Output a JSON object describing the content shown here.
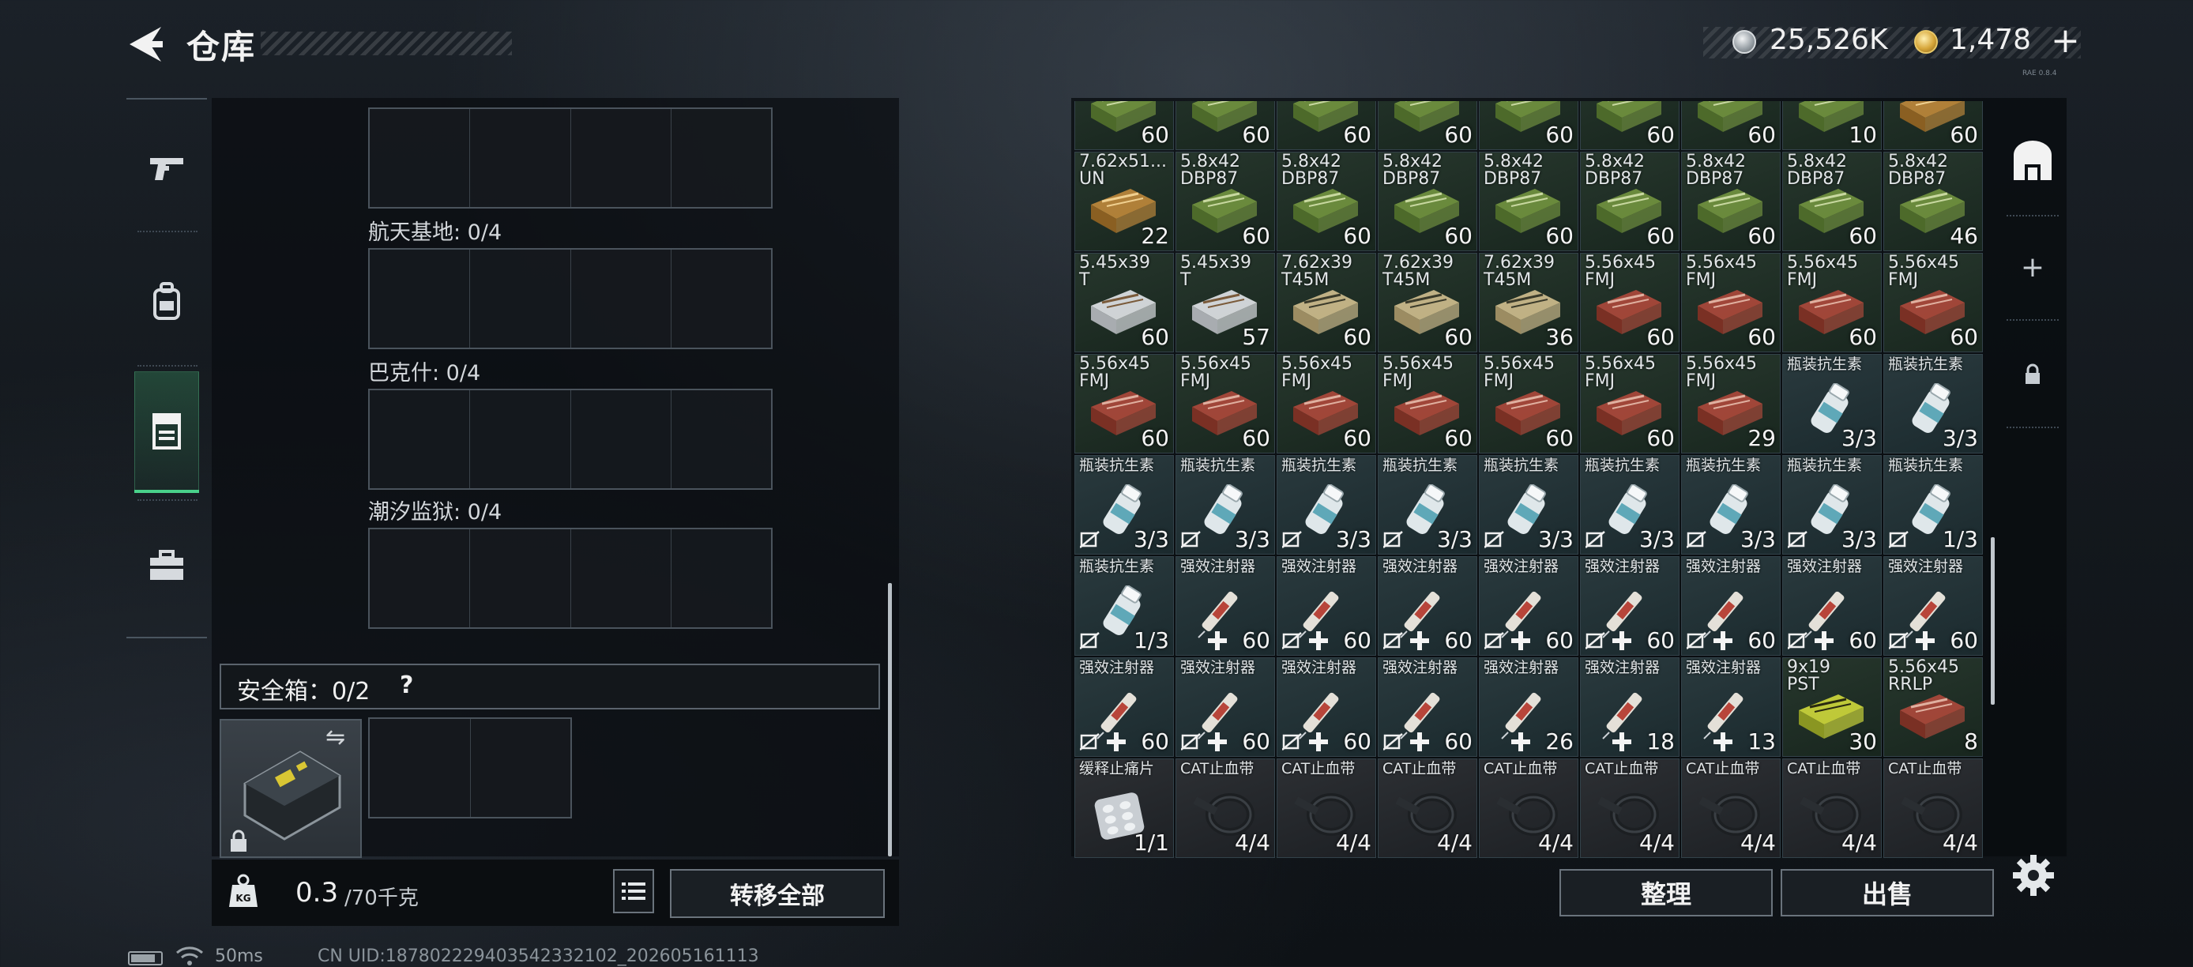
{
  "header": {
    "title": "仓库",
    "currency": {
      "silver_amount": "25,526K",
      "gold_amount": "1,478",
      "add_label": "+"
    },
    "version": "RAE 0.8.4"
  },
  "left_nav": {
    "tabs": [
      {
        "name": "weapons",
        "icon": "pistol-icon",
        "active": false
      },
      {
        "name": "gear",
        "icon": "backpack-icon",
        "active": false
      },
      {
        "name": "storage",
        "icon": "locker-icon",
        "active": true
      },
      {
        "name": "toolbox",
        "icon": "toolbox-icon",
        "active": false
      }
    ]
  },
  "stash": {
    "rows": [
      {
        "label": ""
      },
      {
        "label": "航天基地: 0/4"
      },
      {
        "label": "巴克什: 0/4"
      },
      {
        "label": "潮汐监狱: 0/4"
      }
    ],
    "safebox_label": "安全箱：0/2",
    "safebox_help": "?",
    "weight_current": "0.3",
    "weight_max": "/70千克",
    "transfer_all": "转移全部"
  },
  "inventory": {
    "accent": "#49d18a",
    "items": [
      {
        "name": "",
        "qty": "60",
        "type": "ammo-green"
      },
      {
        "name": "",
        "qty": "60",
        "type": "ammo-green"
      },
      {
        "name": "",
        "qty": "60",
        "type": "ammo-green"
      },
      {
        "name": "",
        "qty": "60",
        "type": "ammo-green"
      },
      {
        "name": "",
        "qty": "60",
        "type": "ammo-green"
      },
      {
        "name": "",
        "qty": "60",
        "type": "ammo-green"
      },
      {
        "name": "",
        "qty": "60",
        "type": "ammo-green"
      },
      {
        "name": "",
        "qty": "10",
        "type": "ammo-green"
      },
      {
        "name": "",
        "qty": "60",
        "type": "ammo-box"
      },
      {
        "name": "7.62x51...\nUN",
        "qty": "22",
        "type": "ammo-box"
      },
      {
        "name": "5.8x42\nDBP87",
        "qty": "60",
        "type": "ammo-green"
      },
      {
        "name": "5.8x42\nDBP87",
        "qty": "60",
        "type": "ammo-green"
      },
      {
        "name": "5.8x42\nDBP87",
        "qty": "60",
        "type": "ammo-green"
      },
      {
        "name": "5.8x42\nDBP87",
        "qty": "60",
        "type": "ammo-green"
      },
      {
        "name": "5.8x42\nDBP87",
        "qty": "60",
        "type": "ammo-green"
      },
      {
        "name": "5.8x42\nDBP87",
        "qty": "60",
        "type": "ammo-green"
      },
      {
        "name": "5.8x42\nDBP87",
        "qty": "60",
        "type": "ammo-green"
      },
      {
        "name": "5.8x42\nDBP87",
        "qty": "46",
        "type": "ammo-green"
      },
      {
        "name": "5.45x39\nT",
        "qty": "60",
        "type": "ammo-white"
      },
      {
        "name": "5.45x39\nT",
        "qty": "57",
        "type": "ammo-white"
      },
      {
        "name": "7.62x39\nT45M",
        "qty": "60",
        "type": "ammo-tan"
      },
      {
        "name": "7.62x39\nT45M",
        "qty": "60",
        "type": "ammo-tan"
      },
      {
        "name": "7.62x39\nT45M",
        "qty": "36",
        "type": "ammo-tan"
      },
      {
        "name": "5.56x45\nFMJ",
        "qty": "60",
        "type": "ammo-red"
      },
      {
        "name": "5.56x45\nFMJ",
        "qty": "60",
        "type": "ammo-red"
      },
      {
        "name": "5.56x45\nFMJ",
        "qty": "60",
        "type": "ammo-red"
      },
      {
        "name": "5.56x45\nFMJ",
        "qty": "60",
        "type": "ammo-red"
      },
      {
        "name": "5.56x45\nFMJ",
        "qty": "60",
        "type": "ammo-red"
      },
      {
        "name": "5.56x45\nFMJ",
        "qty": "60",
        "type": "ammo-red"
      },
      {
        "name": "5.56x45\nFMJ",
        "qty": "60",
        "type": "ammo-red"
      },
      {
        "name": "5.56x45\nFMJ",
        "qty": "60",
        "type": "ammo-red"
      },
      {
        "name": "5.56x45\nFMJ",
        "qty": "60",
        "type": "ammo-red"
      },
      {
        "name": "5.56x45\nFMJ",
        "qty": "60",
        "type": "ammo-red"
      },
      {
        "name": "5.56x45\nFMJ",
        "qty": "29",
        "type": "ammo-red"
      },
      {
        "name": "瓶装抗生素",
        "qty": "3/3",
        "type": "pill-bottle"
      },
      {
        "name": "瓶装抗生素",
        "qty": "3/3",
        "type": "pill-bottle"
      },
      {
        "name": "瓶装抗生素",
        "qty": "3/3",
        "type": "pill-bottle",
        "noins": true
      },
      {
        "name": "瓶装抗生素",
        "qty": "3/3",
        "type": "pill-bottle",
        "noins": true
      },
      {
        "name": "瓶装抗生素",
        "qty": "3/3",
        "type": "pill-bottle",
        "noins": true
      },
      {
        "name": "瓶装抗生素",
        "qty": "3/3",
        "type": "pill-bottle",
        "noins": true
      },
      {
        "name": "瓶装抗生素",
        "qty": "3/3",
        "type": "pill-bottle",
        "noins": true
      },
      {
        "name": "瓶装抗生素",
        "qty": "3/3",
        "type": "pill-bottle",
        "noins": true
      },
      {
        "name": "瓶装抗生素",
        "qty": "3/3",
        "type": "pill-bottle",
        "noins": true
      },
      {
        "name": "瓶装抗生素",
        "qty": "3/3",
        "type": "pill-bottle",
        "noins": true
      },
      {
        "name": "瓶装抗生素",
        "qty": "1/3",
        "type": "pill-bottle",
        "noins": true
      },
      {
        "name": "瓶装抗生素",
        "qty": "1/3",
        "type": "pill-bottle",
        "noins": true
      },
      {
        "name": "强效注射器",
        "qty": "60",
        "type": "syringe",
        "plus": true
      },
      {
        "name": "强效注射器",
        "qty": "60",
        "type": "syringe",
        "plus": true,
        "noins": true
      },
      {
        "name": "强效注射器",
        "qty": "60",
        "type": "syringe",
        "plus": true,
        "noins": true
      },
      {
        "name": "强效注射器",
        "qty": "60",
        "type": "syringe",
        "plus": true,
        "noins": true
      },
      {
        "name": "强效注射器",
        "qty": "60",
        "type": "syringe",
        "plus": true,
        "noins": true
      },
      {
        "name": "强效注射器",
        "qty": "60",
        "type": "syringe",
        "plus": true,
        "noins": true
      },
      {
        "name": "强效注射器",
        "qty": "60",
        "type": "syringe",
        "plus": true,
        "noins": true
      },
      {
        "name": "强效注射器",
        "qty": "60",
        "type": "syringe",
        "plus": true,
        "noins": true
      },
      {
        "name": "强效注射器",
        "qty": "60",
        "type": "syringe",
        "plus": true,
        "noins": true
      },
      {
        "name": "强效注射器",
        "qty": "60",
        "type": "syringe",
        "plus": true,
        "noins": true
      },
      {
        "name": "强效注射器",
        "qty": "60",
        "type": "syringe",
        "plus": true,
        "noins": true
      },
      {
        "name": "强效注射器",
        "qty": "60",
        "type": "syringe",
        "plus": true,
        "noins": true
      },
      {
        "name": "强效注射器",
        "qty": "26",
        "type": "syringe",
        "plus": true
      },
      {
        "name": "强效注射器",
        "qty": "18",
        "type": "syringe",
        "plus": true
      },
      {
        "name": "强效注射器",
        "qty": "13",
        "type": "syringe",
        "plus": true
      },
      {
        "name": "9x19\nPST",
        "qty": "30",
        "type": "ammo-yellow"
      },
      {
        "name": "5.56x45\nRRLP",
        "qty": "8",
        "type": "ammo-red"
      },
      {
        "name": "缓释止痛片",
        "qty": "1/1",
        "type": "pill-pack"
      },
      {
        "name": "CAT止血带",
        "qty": "4/4",
        "type": "tourniquet"
      },
      {
        "name": "CAT止血带",
        "qty": "4/4",
        "type": "tourniquet"
      },
      {
        "name": "CAT止血带",
        "qty": "4/4",
        "type": "tourniquet"
      },
      {
        "name": "CAT止血带",
        "qty": "4/4",
        "type": "tourniquet"
      },
      {
        "name": "CAT止血带",
        "qty": "4/4",
        "type": "tourniquet"
      },
      {
        "name": "CAT止血带",
        "qty": "4/4",
        "type": "tourniquet"
      },
      {
        "name": "CAT止血带",
        "qty": "4/4",
        "type": "tourniquet"
      },
      {
        "name": "CAT止血带",
        "qty": "4/4",
        "type": "tourniquet"
      }
    ],
    "sort_label": "整理",
    "sell_label": "出售"
  },
  "right_nav": {
    "items": [
      {
        "icon": "container-icon"
      },
      {
        "icon": "add-icon",
        "label": "+"
      },
      {
        "icon": "lock-icon"
      }
    ]
  },
  "status": {
    "ping": "50ms",
    "uid": "CN UID:18780222940354233210​2_202605161113"
  }
}
